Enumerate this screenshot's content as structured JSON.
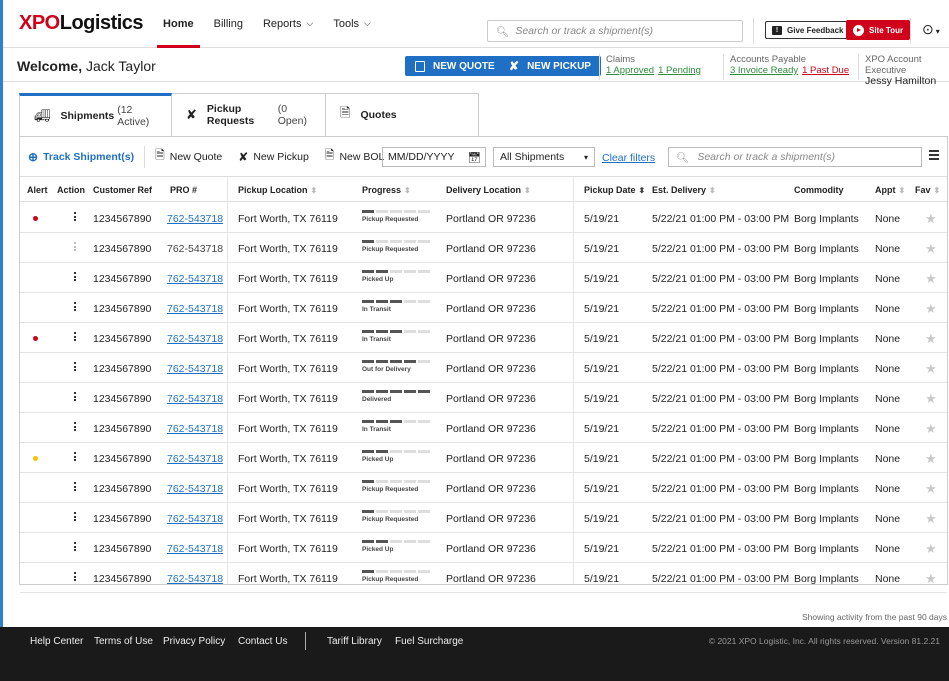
{
  "colors": {
    "brand_red": "#d0021b",
    "accent_blue": "#1f6fc4",
    "link_green": "#2f8b3e",
    "alert_red": "#d0021b",
    "alert_yellow": "#f2c400"
  },
  "logo": {
    "xpo": "XPO",
    "rest": "Logistics"
  },
  "nav": [
    {
      "label": "Home",
      "chevron": false
    },
    {
      "label": "Billing",
      "chevron": false
    },
    {
      "label": "Reports",
      "chevron": true
    },
    {
      "label": "Tools",
      "chevron": true
    }
  ],
  "top_search": {
    "placeholder": "Search or track a shipment(s)",
    "icon": "search-icon"
  },
  "header_buttons": {
    "feedback": "Give Feedback",
    "tour": "Site Tour"
  },
  "welcome": {
    "prefix": "Welcome,",
    "name": "Jack Taylor"
  },
  "actions": {
    "new_quote": "NEW QUOTE",
    "new_pickup": "NEW PICKUP"
  },
  "claims": {
    "label": "Claims",
    "approved": "1 Approved",
    "pending": "1 Pending"
  },
  "ap": {
    "label": "Accounts Payable",
    "ready": "3 Invoice Ready",
    "past_due": "1 Past Due"
  },
  "exec": {
    "label": "XPO Account Executive",
    "name": "Jessy Hamilton"
  },
  "tabs": [
    {
      "label": "Shipments",
      "count": "(12 Active)",
      "icon": "truck-icon"
    },
    {
      "label": "Pickup Requests",
      "count": "(0 Open)",
      "icon": "dolly-icon"
    },
    {
      "label": "Quotes",
      "count": "",
      "icon": "dollar-doc-icon"
    }
  ],
  "toolbar": {
    "track": "Track Shipment(s)",
    "new_quote": "New Quote",
    "new_pickup": "New Pickup",
    "new_bol": "New BOL",
    "date_placeholder": "MM/DD/YYYY",
    "filter": "All Shipments",
    "clear": "Clear filters",
    "search_placeholder": "Search or track a shipment(s)"
  },
  "columns": [
    "Alert",
    "Action",
    "Customer Ref",
    "PRO #",
    "Pickup Location",
    "Progress",
    "Delivery Location",
    "Pickup Date",
    "Est. Delivery",
    "Commodity",
    "Appt",
    "Fav"
  ],
  "rows": [
    {
      "alert": "red",
      "ref": "1234567890",
      "pro": "762-543718",
      "pro_link": true,
      "pickup": "Fort Worth, TX 76119",
      "progress": "Pickup Requested",
      "steps": 1,
      "delivery": "Portland OR 97236",
      "date": "5/19/21",
      "est": "5/22/21 01:00 PM - 03:00 PM",
      "commodity": "Borg Implants",
      "appt": "None"
    },
    {
      "alert": "",
      "ref": "1234567890",
      "pro": "762-543718",
      "pro_link": false,
      "pickup": "Fort Worth, TX 76119",
      "progress": "Pickup Requested",
      "steps": 1,
      "delivery": "Portland OR 97236",
      "date": "5/19/21",
      "est": "5/22/21 01:00 PM - 03:00 PM",
      "commodity": "Borg Implants",
      "appt": "None"
    },
    {
      "alert": "",
      "ref": "1234567890",
      "pro": "762-543718",
      "pro_link": true,
      "pickup": "Fort Worth, TX 76119",
      "progress": "Picked Up",
      "steps": 2,
      "delivery": "Portland OR 97236",
      "date": "5/19/21",
      "est": "5/22/21 01:00 PM - 03:00 PM",
      "commodity": "Borg Implants",
      "appt": "None"
    },
    {
      "alert": "",
      "ref": "1234567890",
      "pro": "762-543718",
      "pro_link": true,
      "pickup": "Fort Worth, TX 76119",
      "progress": "In Transit",
      "steps": 3,
      "delivery": "Portland OR 97236",
      "date": "5/19/21",
      "est": "5/22/21 01:00 PM - 03:00 PM",
      "commodity": "Borg Implants",
      "appt": "None"
    },
    {
      "alert": "red",
      "ref": "1234567890",
      "pro": "762-543718",
      "pro_link": true,
      "pickup": "Fort Worth, TX 76119",
      "progress": "In Transit",
      "steps": 3,
      "delivery": "Portland OR 97236",
      "date": "5/19/21",
      "est": "5/22/21 01:00 PM - 03:00 PM",
      "commodity": "Borg Implants",
      "appt": "None"
    },
    {
      "alert": "",
      "ref": "1234567890",
      "pro": "762-543718",
      "pro_link": true,
      "pickup": "Fort Worth, TX 76119",
      "progress": "Out for Delivery",
      "steps": 4,
      "delivery": "Portland OR 97236",
      "date": "5/19/21",
      "est": "5/22/21 01:00 PM - 03:00 PM",
      "commodity": "Borg Implants",
      "appt": "None"
    },
    {
      "alert": "",
      "ref": "1234567890",
      "pro": "762-543718",
      "pro_link": true,
      "pickup": "Fort Worth, TX 76119",
      "progress": "Delivered",
      "steps": 5,
      "delivery": "Portland OR 97236",
      "date": "5/19/21",
      "est": "5/22/21 01:00 PM - 03:00 PM",
      "commodity": "Borg Implants",
      "appt": "None"
    },
    {
      "alert": "",
      "ref": "1234567890",
      "pro": "762-543718",
      "pro_link": true,
      "pickup": "Fort Worth, TX 76119",
      "progress": "In Transit",
      "steps": 3,
      "delivery": "Portland OR 97236",
      "date": "5/19/21",
      "est": "5/22/21 01:00 PM - 03:00 PM",
      "commodity": "Borg Implants",
      "appt": "None"
    },
    {
      "alert": "yellow",
      "ref": "1234567890",
      "pro": "762-543718",
      "pro_link": true,
      "pickup": "Fort Worth, TX 76119",
      "progress": "Picked Up",
      "steps": 2,
      "delivery": "Portland OR 97236",
      "date": "5/19/21",
      "est": "5/22/21 01:00 PM - 03:00 PM",
      "commodity": "Borg Implants",
      "appt": "None"
    },
    {
      "alert": "",
      "ref": "1234567890",
      "pro": "762-543718",
      "pro_link": true,
      "pickup": "Fort Worth, TX 76119",
      "progress": "Pickup Requested",
      "steps": 1,
      "delivery": "Portland OR 97236",
      "date": "5/19/21",
      "est": "5/22/21 01:00 PM - 03:00 PM",
      "commodity": "Borg Implants",
      "appt": "None"
    },
    {
      "alert": "",
      "ref": "1234567890",
      "pro": "762-543718",
      "pro_link": true,
      "pickup": "Fort Worth, TX 76119",
      "progress": "Pickup Requested",
      "steps": 1,
      "delivery": "Portland OR 97236",
      "date": "5/19/21",
      "est": "5/22/21 01:00 PM - 03:00 PM",
      "commodity": "Borg Implants",
      "appt": "None"
    },
    {
      "alert": "",
      "ref": "1234567890",
      "pro": "762-543718",
      "pro_link": true,
      "pickup": "Fort Worth, TX 76119",
      "progress": "Picked Up",
      "steps": 2,
      "delivery": "Portland OR 97236",
      "date": "5/19/21",
      "est": "5/22/21 01:00 PM - 03:00 PM",
      "commodity": "Borg Implants",
      "appt": "None"
    },
    {
      "alert": "",
      "ref": "1234567890",
      "pro": "762-543718",
      "pro_link": true,
      "pickup": "Fort Worth, TX 76119",
      "progress": "Pickup Requested",
      "steps": 1,
      "delivery": "Portland OR 97236",
      "date": "5/19/21",
      "est": "5/22/21 01:00 PM - 03:00 PM",
      "commodity": "Borg Implants",
      "appt": "None"
    }
  ],
  "activity_note": "Showing activity from the past 90 days",
  "footer": {
    "links": [
      "Help Center",
      "Terms of Use",
      "Privacy Policy",
      "Contact Us",
      "Tariff Library",
      "Fuel Surcharge"
    ],
    "copyright": "© 2021 XPO Logistic, Inc. All rights reserved. Version 81.2.21"
  }
}
